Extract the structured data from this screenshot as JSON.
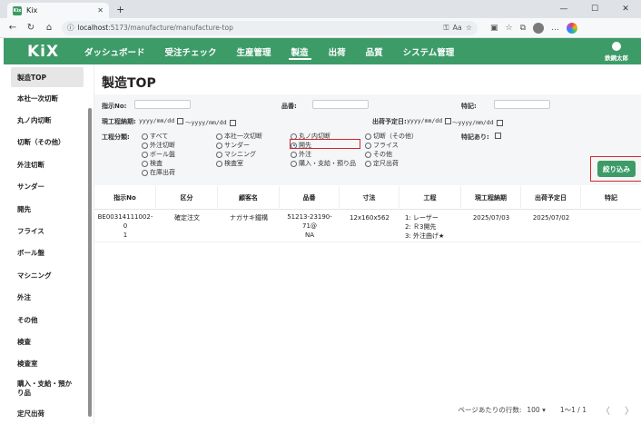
{
  "browser": {
    "tab_title": "Kix",
    "favicon_text": "Kix",
    "url_host": "localhost",
    "url_path": ":5173/manufacture/manufacture-top"
  },
  "nav": {
    "logo": "KiX",
    "items": [
      "ダッシュボード",
      "受注チェック",
      "生産管理",
      "製造",
      "出荷",
      "品質",
      "システム管理"
    ],
    "active": "製造",
    "user": "鉄鋼太郎"
  },
  "sidebar": [
    "製造TOP",
    "本社一次切断",
    "丸ノ内切断",
    "切断（その他）",
    "外注切断",
    "サンダー",
    "開先",
    "フライス",
    "ボール盤",
    "マシニング",
    "外注",
    "その他",
    "検査",
    "検査室",
    "購入・支給・預かり品",
    "定尺出荷"
  ],
  "page": {
    "title": "製造TOP"
  },
  "filters": {
    "shiji_label": "指示No:",
    "hinban_label": "品番:",
    "tokki_label": "特記:",
    "genkotei_label": "現工程納期:",
    "shukka_label": "出荷予定日:",
    "date_ph": "yyyy/mm/dd",
    "tilde": "〜",
    "bunrui_label": "工程分類:",
    "tokki_ari_label": "特記あり:",
    "options": [
      [
        "すべて",
        "本社一次切断",
        "丸ノ内切断",
        "切断（その他）"
      ],
      [
        "外注切断",
        "サンダー",
        "開先",
        "フライス"
      ],
      [
        "ボール盤",
        "マシニング",
        "外注",
        "その他"
      ],
      [
        "検査",
        "検査室",
        "購入・支給・預り品",
        "定尺出荷"
      ],
      [
        "在庫出荷"
      ]
    ],
    "selected": "開先",
    "search_button": "絞り込み"
  },
  "table": {
    "headers": [
      "指示No",
      "区分",
      "顧客名",
      "品番",
      "寸法",
      "工程",
      "現工程納期",
      "出荷予定日",
      "特記"
    ],
    "rows": [
      {
        "shiji": "BE00314111002-0",
        "shiji2": "1",
        "kubun": "確定注文",
        "kokyaku": "ナガサキ鐵構 ",
        "hinban": "51213-23190-71@",
        "hinban2": "NA",
        "sunpo": "12x160x562",
        "kotei1": "1: レーザー",
        "kotei2": "2: Ｒ3開先",
        "kotei3": "3: 外注曲げ★",
        "genkotei": "2025/07/03",
        "shukka": "2025/07/02",
        "tokki": ""
      }
    ]
  },
  "footer": {
    "rows_per_page_label": "ページあたりの行数:",
    "rows_per_page": "100",
    "range": "1〜1 / 1",
    "prev": "〈",
    "next": "〉"
  }
}
